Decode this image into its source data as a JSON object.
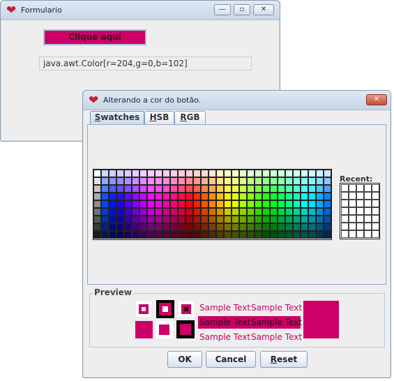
{
  "window1": {
    "title": "Formulario",
    "button_label": "Clique aqui",
    "color_text": "java.awt.Color[r=204,g=0,b=102]"
  },
  "dialog": {
    "title": "Alterando a cor do botão.",
    "tabs": [
      {
        "label": "Swatches",
        "mnemonic": "S",
        "rest": "watches"
      },
      {
        "label": "HSB",
        "mnemonic": "H",
        "rest": "SB"
      },
      {
        "label": "RGB",
        "mnemonic": "R",
        "rest": "GB"
      }
    ],
    "recent_label": "Recent:",
    "preview_label": "Preview",
    "sample_text": "Sample Text",
    "buttons": {
      "ok": "OK",
      "cancel": "Cancel",
      "reset": "Reset",
      "reset_mnemonic": "R",
      "reset_rest": "eset"
    }
  },
  "colors": {
    "selected": "#cc0066",
    "accent_border": "#7f9db9"
  }
}
